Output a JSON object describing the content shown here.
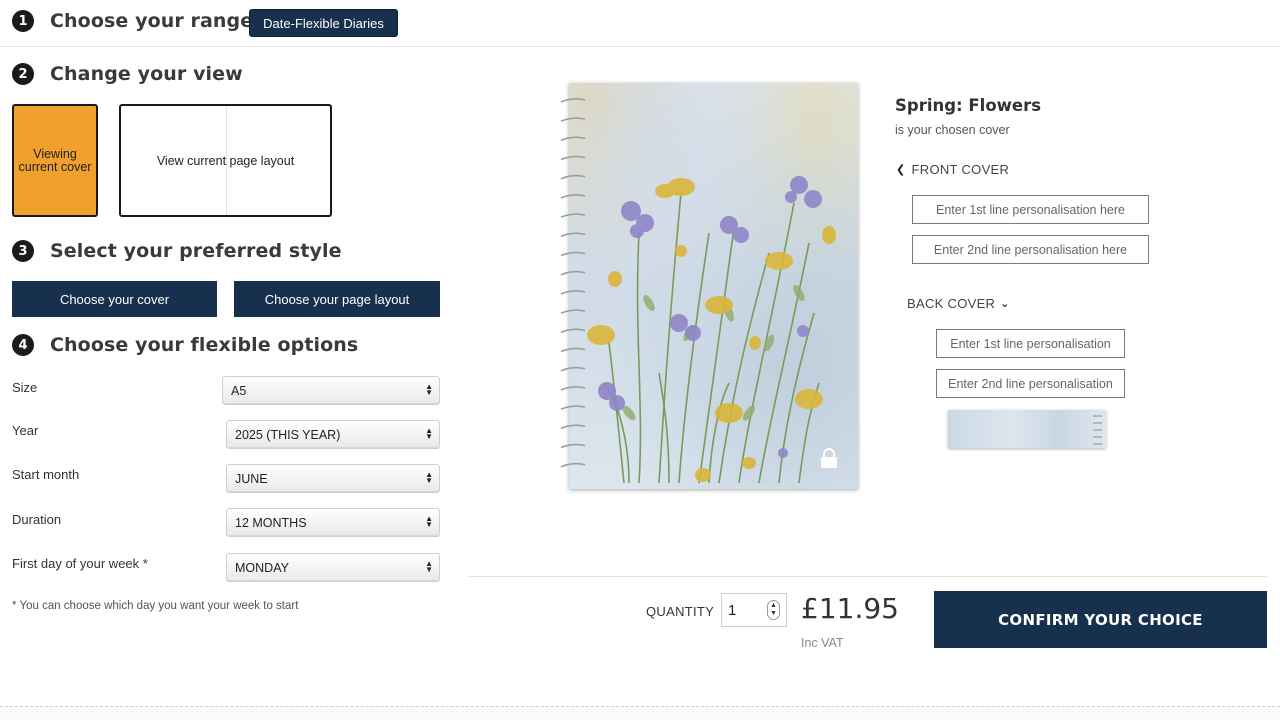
{
  "steps": {
    "range": {
      "num": "1",
      "title": "Choose your range",
      "badge": "Date-Flexible Diaries"
    },
    "view": {
      "num": "2",
      "title": "Change your view",
      "current_cover": "Viewing current cover",
      "page_layout": "View current page layout"
    },
    "style": {
      "num": "3",
      "title": "Select your preferred style",
      "choose_cover": "Choose your cover",
      "choose_layout": "Choose your page layout"
    },
    "options": {
      "num": "4",
      "title": "Choose your flexible options"
    }
  },
  "options": [
    {
      "label": "Size",
      "value": "A5"
    },
    {
      "label": "Year",
      "value": "2025 (THIS YEAR)"
    },
    {
      "label": "Start month",
      "value": "JUNE"
    },
    {
      "label": "Duration",
      "value": "12 MONTHS"
    },
    {
      "label": "First day of your week *",
      "value": "MONDAY"
    }
  ],
  "footnote": "* You can choose which day you want your week to start",
  "cover": {
    "name": "Spring: Flowers",
    "subtitle": "is your chosen cover",
    "front_label": "FRONT COVER",
    "front_line1_placeholder": "Enter 1st line personalisation here",
    "front_line2_placeholder": "Enter 2nd line personalisation here",
    "back_label": "BACK COVER",
    "back_line1_placeholder": "Enter 1st line personalisation",
    "back_line2_placeholder": "Enter 2nd line personalisation"
  },
  "purchase": {
    "quantity_label": "QUANTITY",
    "quantity": "1",
    "price": "£11.95",
    "vat": "Inc VAT",
    "confirm": "CONFIRM YOUR CHOICE"
  },
  "colors": {
    "navy": "#16304d",
    "orange": "#f0a02c"
  }
}
